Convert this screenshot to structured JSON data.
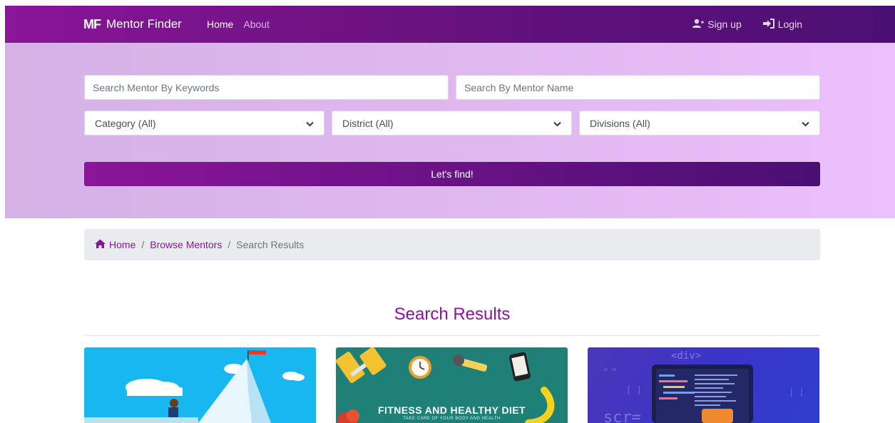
{
  "navbar": {
    "logo": "MF",
    "brand": "Mentor Finder",
    "links": {
      "home": "Home",
      "about": "About"
    },
    "signup": "Sign up",
    "login": "Login"
  },
  "search": {
    "keywords_placeholder": "Search Mentor By Keywords",
    "name_placeholder": "Search By Mentor Name",
    "category": "Category (All)",
    "district": "District (All)",
    "divisions": "Divisions (All)",
    "button": "Let's find!"
  },
  "breadcrumb": {
    "home": "Home",
    "browse": "Browse Mentors",
    "current": "Search Results",
    "separator": "/"
  },
  "results": {
    "title": "Search Results",
    "cards": [
      {
        "theme": "mountain-climb"
      },
      {
        "headline": "FITNESS AND HEALTHY DIET",
        "subline": "TAKE CARE OF YOUR BODY AND HEALTH"
      },
      {
        "tag": "<div>",
        "code_text": "scr="
      }
    ]
  },
  "colors": {
    "accent": "#8a1598",
    "nav_end": "#4a0f72",
    "hero_bg": "#e0b8f0",
    "breadcrumb_bg": "#e9ecef"
  }
}
